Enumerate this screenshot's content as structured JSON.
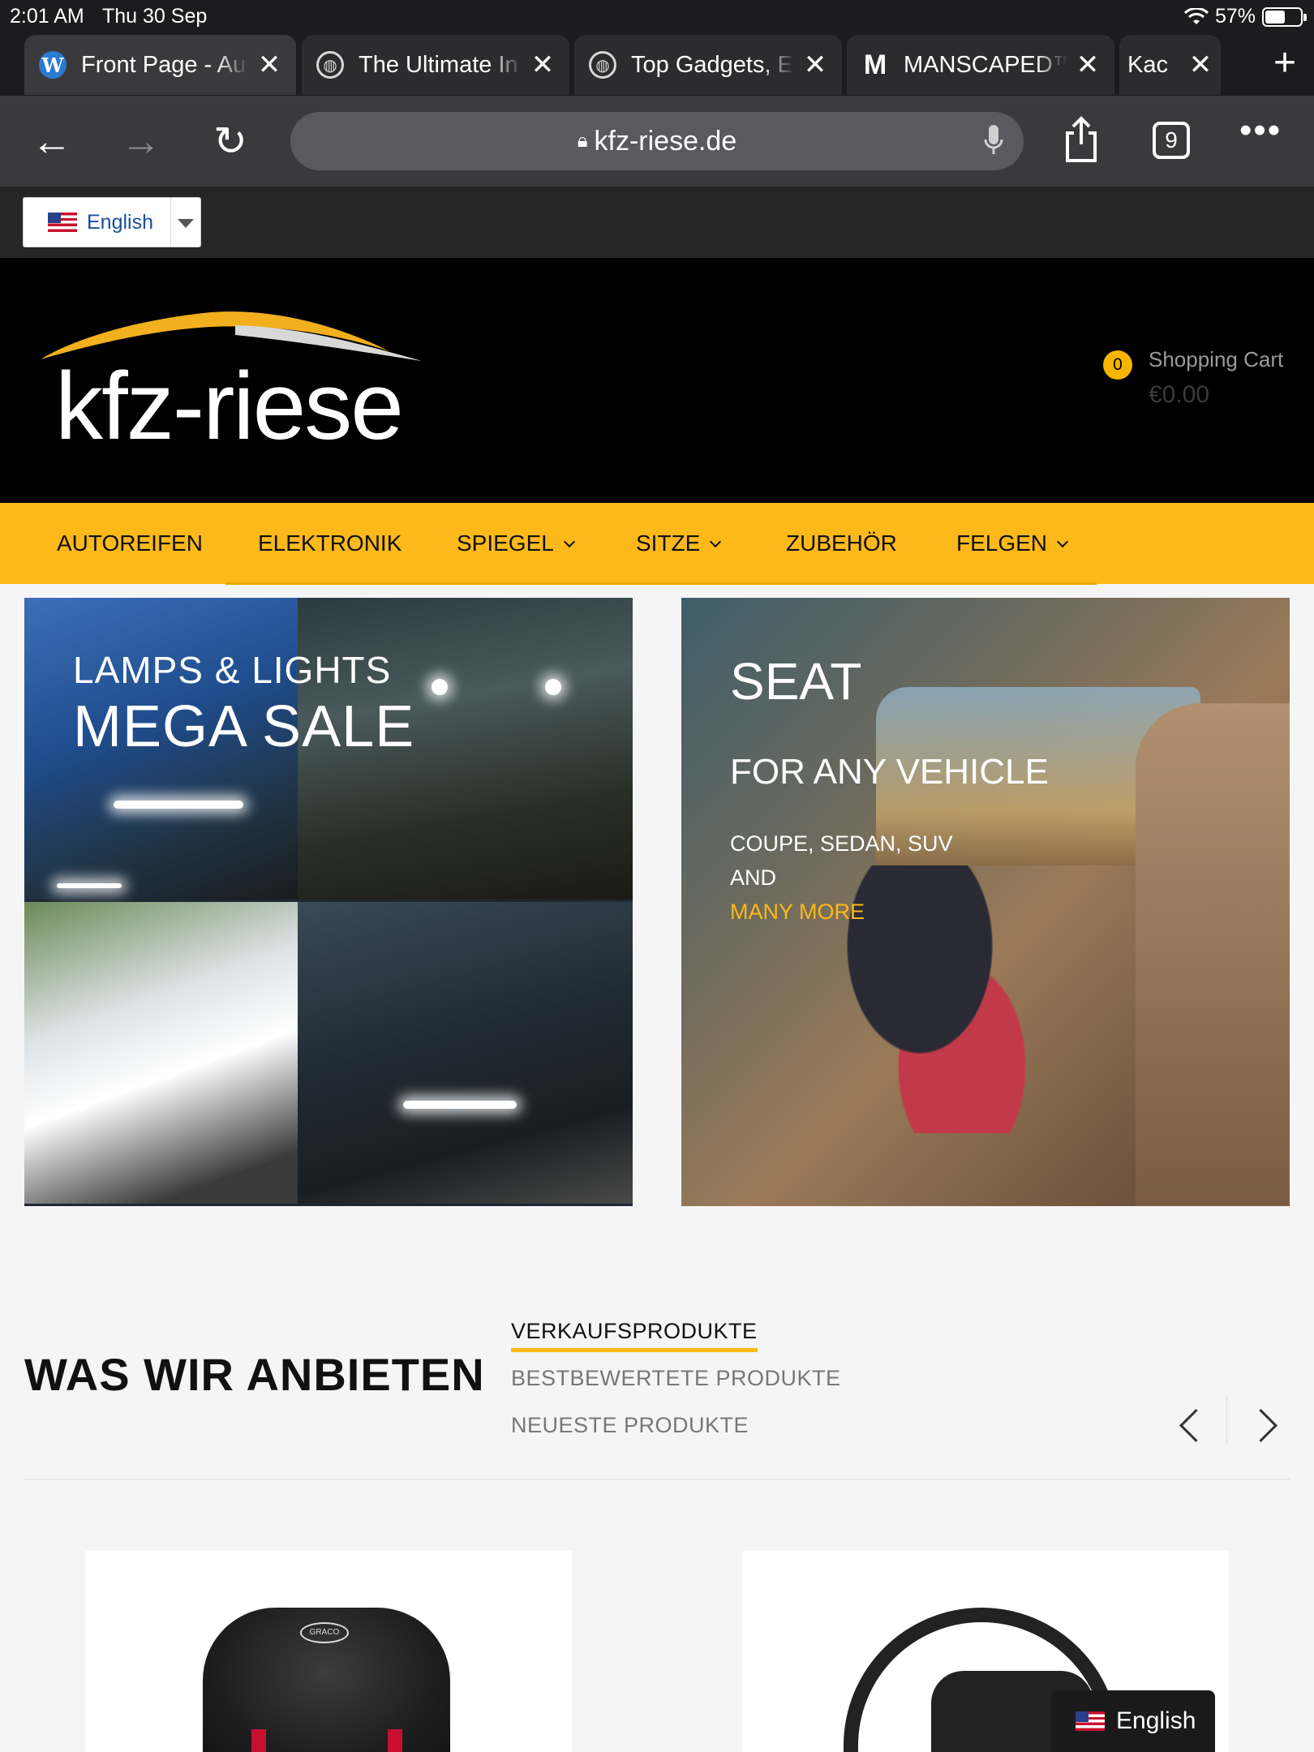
{
  "status": {
    "time": "2:01 AM",
    "date": "Thu 30 Sep",
    "battery": "57%",
    "battery_level": 0.57
  },
  "browser": {
    "tabs": [
      {
        "title": "Front Page - Au",
        "favicon": "wordpress-icon"
      },
      {
        "title": "The Ultimate In",
        "favicon": "globe-icon"
      },
      {
        "title": "Top Gadgets, E",
        "favicon": "globe-icon"
      },
      {
        "title": "MANSCAPED™",
        "favicon": "m-logo-icon"
      },
      {
        "title": "Kac",
        "favicon": "none"
      }
    ],
    "url": "kfz-riese.de",
    "tab_count": "9"
  },
  "language": {
    "selected": "English"
  },
  "header": {
    "logo_text": "kfz-riese",
    "cart_count": "0",
    "cart_label": "Shopping Cart",
    "cart_amount": "€0.00"
  },
  "nav": {
    "items": [
      {
        "label": "AUTOREIFEN"
      },
      {
        "label": "ELEKTRONIK"
      },
      {
        "label": "SPIEGEL"
      },
      {
        "label": "SITZE"
      },
      {
        "label": "ZUBEHÖR"
      },
      {
        "label": "FELGEN"
      }
    ]
  },
  "banners": {
    "lamps": {
      "small": "LAMPS & LIGHTS",
      "big": "MEGA SALE"
    },
    "seat": {
      "title": "SEAT",
      "subtitle": "FOR ANY VEHICLE",
      "line1": "COUPE, SEDAN, SUV",
      "line2": "AND",
      "more": "MANY MORE"
    }
  },
  "products": {
    "title": "WAS WIR ANBIETEN",
    "tabs": [
      {
        "label": "VERKAUFSPRODUKTE"
      },
      {
        "label": "BESTBEWERTETE PRODUKTE"
      },
      {
        "label": "NEUESTE PRODUKTE"
      }
    ],
    "brand_badge": "GRACO"
  },
  "floating_language": {
    "label": "English"
  },
  "colors": {
    "accent": "#fdb91a",
    "header_bg": "#000000",
    "browser_bg": "#3a3a3c"
  }
}
